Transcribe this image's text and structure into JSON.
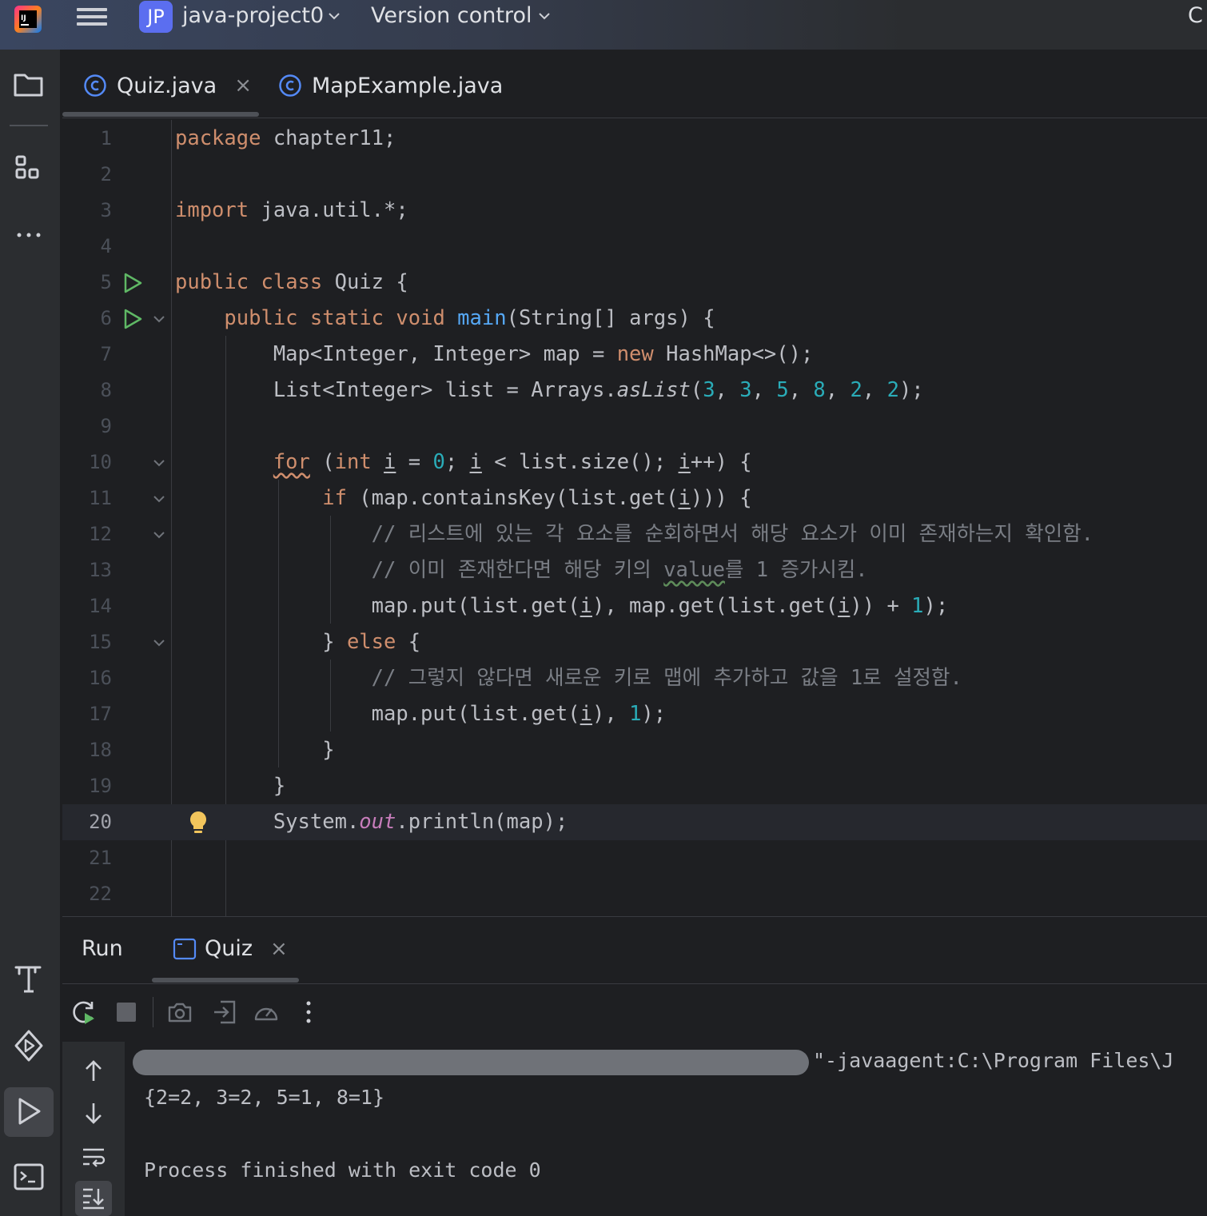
{
  "titlebar": {
    "project_badge": "JP",
    "project_name": "java-project0",
    "vcs_label": "Version control",
    "right_cut_text": "C"
  },
  "tabs": [
    {
      "label": "Quiz.java",
      "active": true
    },
    {
      "label": "MapExample.java",
      "active": false
    }
  ],
  "tab_close": "×",
  "editor": {
    "line_numbers": [
      "1",
      "2",
      "3",
      "4",
      "5",
      "6",
      "7",
      "8",
      "9",
      "10",
      "11",
      "12",
      "13",
      "14",
      "15",
      "16",
      "17",
      "18",
      "19",
      "20",
      "21",
      "22"
    ],
    "current_line": 20,
    "line1": {
      "kw": "package",
      "rest": " chapter11;"
    },
    "line3": {
      "kw": "import",
      "rest": " java.util.*;"
    },
    "line5": {
      "kw1": "public",
      "kw2": "class",
      "rest": " Quiz {"
    },
    "line6": {
      "kw1": "public",
      "kw2": "static",
      "kw3": "void",
      "fn": "main",
      "rest": "(String[] args) {"
    },
    "line7": {
      "a": "Map<Integer, Integer> map = ",
      "kw": "new",
      "b": " HashMap<>();"
    },
    "line8": {
      "a": "List<Integer> list = Arrays.",
      "m": "asList",
      "b": "(",
      "nums": [
        "3",
        "3",
        "5",
        "8",
        "2",
        "2"
      ],
      "sep": ", ",
      "end": ");"
    },
    "line10": {
      "kw": "for",
      "a": " (",
      "kw2": "int",
      "b": " ",
      "i": "i",
      "c": " = ",
      "zero": "0",
      "d": "; ",
      "e": " < list.size(); ",
      "f": "++) {"
    },
    "line11": {
      "kw": "if",
      "a": " (map.containsKey(list.get(",
      "i": "i",
      "b": "))) {"
    },
    "line12": {
      "comment": "// 리스트에 있는 각 요소를 순회하면서 해당 요소가 이미 존재하는지 확인함."
    },
    "line13": {
      "a": "// 이미 존재한다면 해당 키의 ",
      "w": "value",
      "b": "를 1 증가시킴."
    },
    "line14": {
      "a": "map.put(list.get(",
      "i": "i",
      "b": "), map.get(list.get(",
      "c": ")) + ",
      "one": "1",
      "d": ");"
    },
    "line15": {
      "a": "} ",
      "kw": "else",
      "b": " {"
    },
    "line16": {
      "comment": "// 그렇지 않다면 새로운 키로 맵에 추가하고 값을 1로 설정함."
    },
    "line17": {
      "a": "map.put(list.get(",
      "i": "i",
      "b": "), ",
      "one": "1",
      "c": ");"
    },
    "line18": {
      "text": "}"
    },
    "line19": {
      "text": "}"
    },
    "line20": {
      "a": "System.",
      "f": "out",
      "b": ".println(map);"
    }
  },
  "run_panel": {
    "title": "Run",
    "tab_label": "Quiz",
    "close": "×",
    "console": {
      "command_tail": "\"-javaagent:C:\\Program Files\\J",
      "output": "{2=2, 3=2, 5=1, 8=1}",
      "exit_message": "Process finished with exit code 0"
    }
  },
  "icons": [
    "intellij-logo-icon",
    "hamburger-menu-icon",
    "chevron-down-icon",
    "folder-icon",
    "structure-icon",
    "more-icon",
    "build-hammer-icon",
    "services-icon",
    "run-icon",
    "terminal-icon",
    "class-icon",
    "rerun-icon",
    "stop-icon",
    "camera-icon",
    "exit-icon",
    "profiler-icon",
    "more-vertical-icon",
    "arrow-up-icon",
    "arrow-down-icon",
    "soft-wrap-icon",
    "scroll-end-icon",
    "lightbulb-icon",
    "fold-icon"
  ],
  "colors": {
    "keyword": "#cf8e6d",
    "function": "#56a8f5",
    "number": "#2aacb8",
    "comment": "#7a7e85",
    "static_field": "#c77dbb",
    "run_green": "#5fb865",
    "accent": "#5b6ef0"
  }
}
